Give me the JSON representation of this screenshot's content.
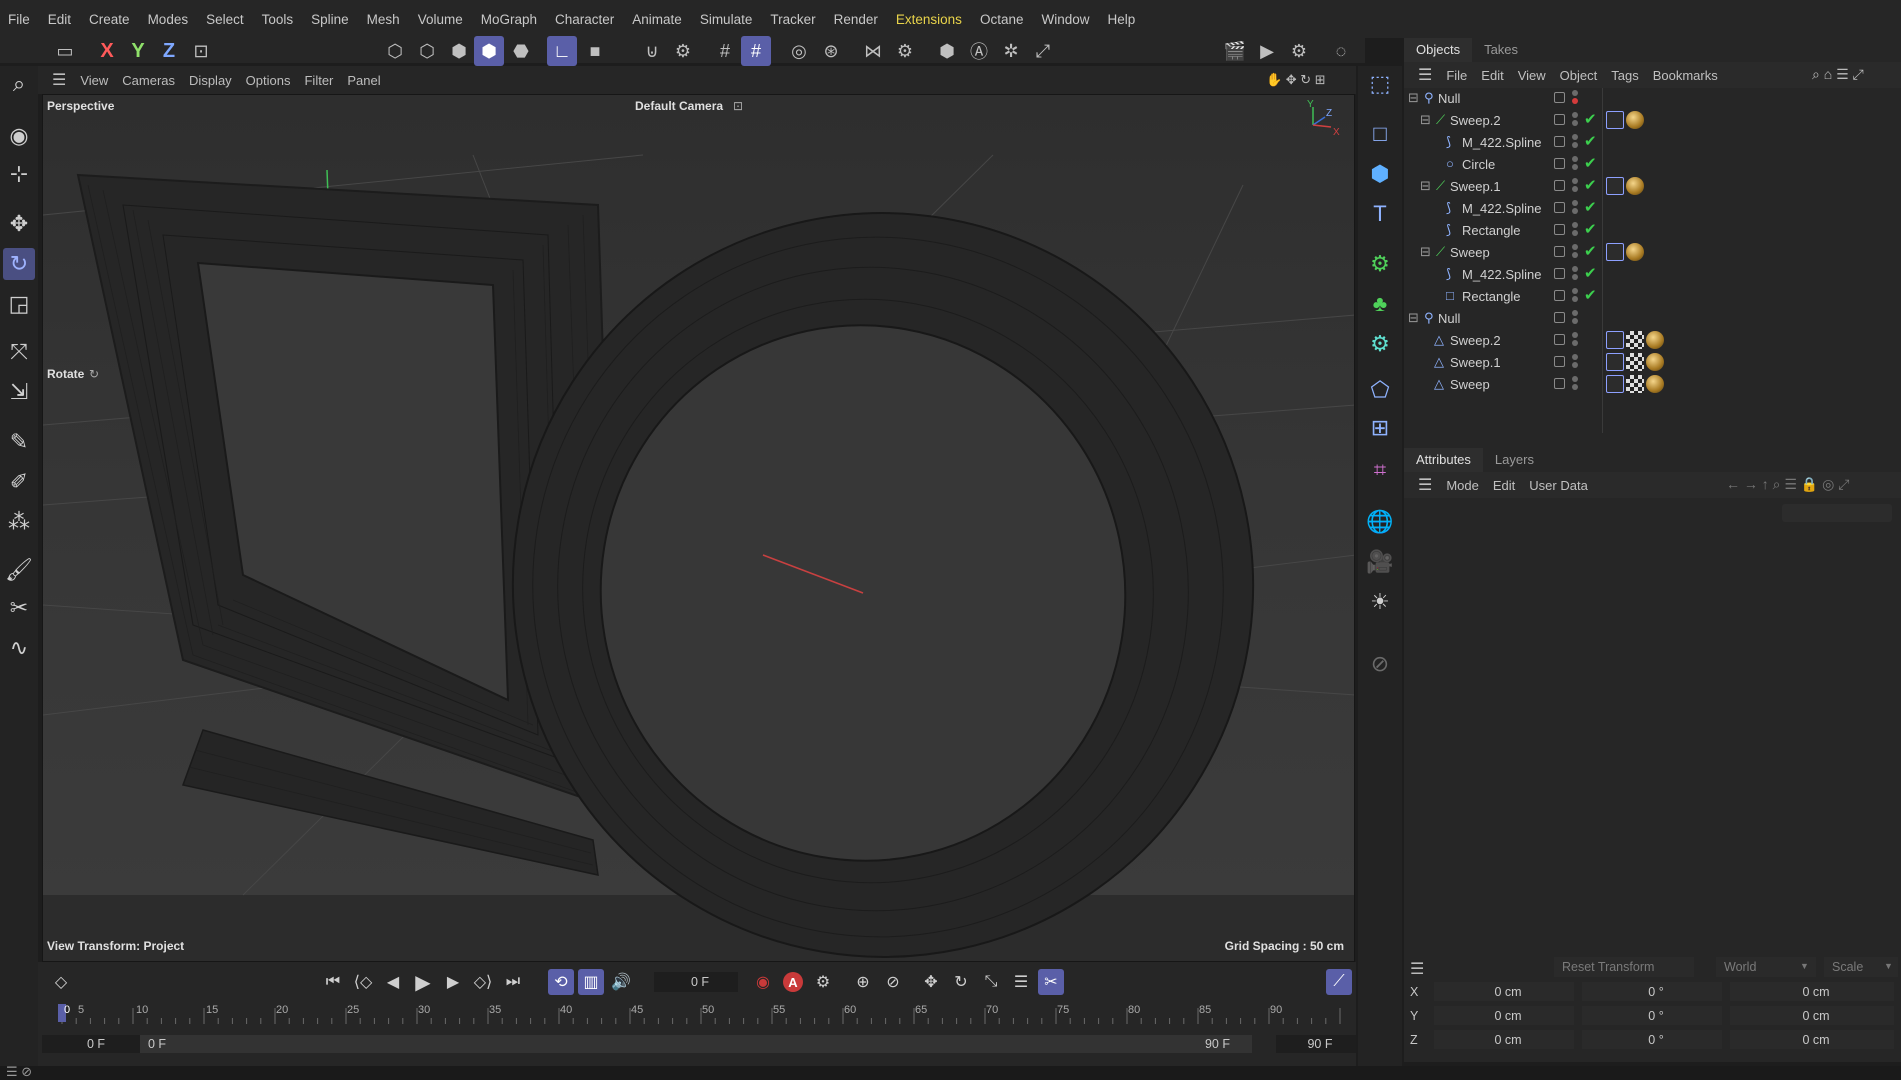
{
  "menu": [
    "File",
    "Edit",
    "Create",
    "Modes",
    "Select",
    "Tools",
    "Spline",
    "Mesh",
    "Volume",
    "MoGraph",
    "Character",
    "Animate",
    "Simulate",
    "Tracker",
    "Render",
    "Extensions",
    "Octane",
    "Window",
    "Help"
  ],
  "viewport": {
    "menu": [
      "View",
      "Cameras",
      "Display",
      "Options",
      "Filter",
      "Panel"
    ],
    "projection": "Perspective",
    "camera": "Default Camera",
    "tool_label": "Rotate",
    "view_transform": "View Transform: Project",
    "grid_spacing": "Grid Spacing : 50 cm",
    "axis_labels": {
      "y": "Y",
      "z": "Z",
      "x": "X"
    }
  },
  "toolbar": {
    "axis_x": "X",
    "axis_y": "Y",
    "axis_z": "Z"
  },
  "objects_panel": {
    "tabs": [
      "Objects",
      "Takes"
    ],
    "menu": [
      "File",
      "Edit",
      "View",
      "Object",
      "Tags",
      "Bookmarks"
    ],
    "rows": [
      {
        "name": "Null"
      },
      {
        "name": "Sweep.2"
      },
      {
        "name": "M_422.Spline"
      },
      {
        "name": "Circle"
      },
      {
        "name": "Sweep.1"
      },
      {
        "name": "M_422.Spline"
      },
      {
        "name": "Rectangle"
      },
      {
        "name": "Sweep"
      },
      {
        "name": "M_422.Spline"
      },
      {
        "name": "Rectangle"
      },
      {
        "name": "Null"
      },
      {
        "name": "Sweep.2"
      },
      {
        "name": "Sweep.1"
      },
      {
        "name": "Sweep"
      }
    ]
  },
  "attributes_panel": {
    "tabs": [
      "Attributes",
      "Layers"
    ],
    "menu": [
      "Mode",
      "Edit",
      "User Data"
    ]
  },
  "coordinates": {
    "reset": "Reset Transform",
    "space": "World",
    "mode": "Scale",
    "rows": [
      {
        "axis": "X",
        "pos": "0 cm",
        "rot": "0 °",
        "scale": "0 cm"
      },
      {
        "axis": "Y",
        "pos": "0 cm",
        "rot": "0 °",
        "scale": "0 cm"
      },
      {
        "axis": "Z",
        "pos": "0 cm",
        "rot": "0 °",
        "scale": "0 cm"
      }
    ]
  },
  "timeline": {
    "current_frame": "0 F",
    "ticks": [
      "0",
      "5",
      "10",
      "15",
      "20",
      "25",
      "30",
      "35",
      "40",
      "45",
      "50",
      "55",
      "60",
      "65",
      "70",
      "75",
      "80",
      "85",
      "90"
    ],
    "start_field": "0 F",
    "range_start": "0 F",
    "range_end": "90 F",
    "end_field": "90 F",
    "auto_key": "A"
  }
}
